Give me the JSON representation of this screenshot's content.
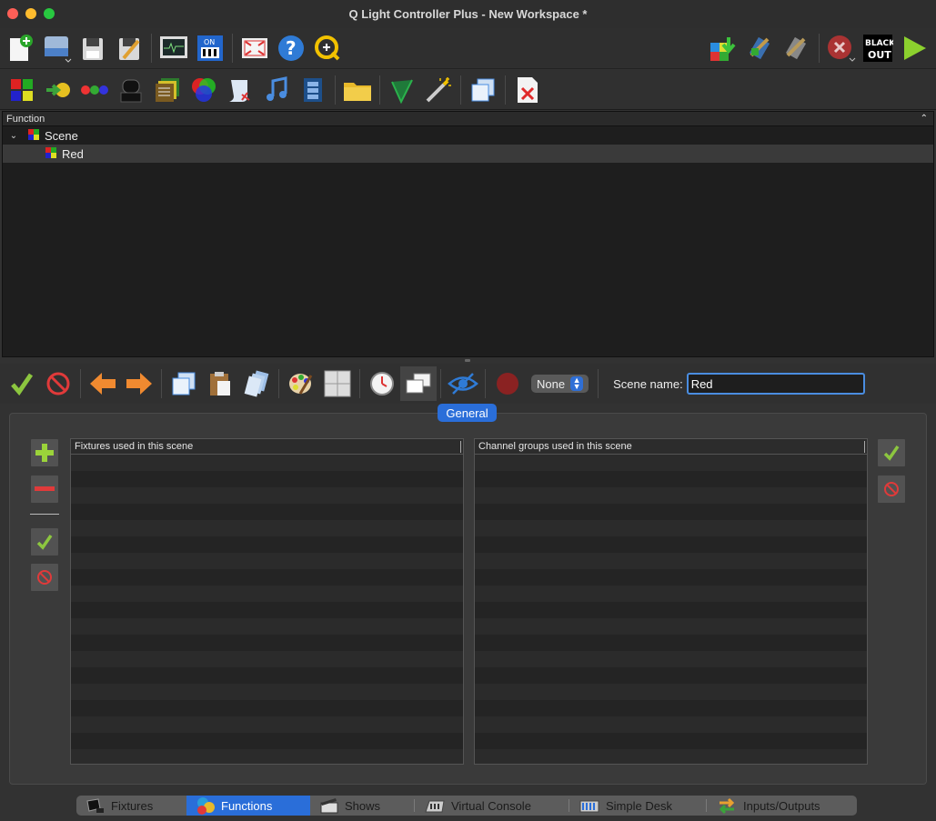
{
  "window": {
    "title": "Q Light Controller Plus - New Workspace *"
  },
  "main_toolbar": {
    "items": [
      "new-workspace",
      "open-workspace",
      "save-workspace",
      "save-as",
      "monitor",
      "dmx-dump",
      "fullscreen",
      "help",
      "about"
    ],
    "right_items": [
      "load-address-tool",
      "fixture-remap",
      "fixture-remap-alt",
      "stop-all",
      "blackout",
      "start-operate"
    ],
    "blackout_label_1": "BLACK",
    "blackout_label_2": "OUT"
  },
  "function_toolbar": {
    "items": [
      "new-scene",
      "new-chaser",
      "new-sequence",
      "new-efx",
      "new-collection",
      "new-rgb-matrix",
      "new-script",
      "new-audio",
      "new-show",
      "new-folder",
      "wizard-chaser",
      "function-wizard",
      "clone",
      "delete"
    ]
  },
  "function_tree": {
    "header": "Function",
    "items": [
      {
        "label": "Scene",
        "expanded": true,
        "children": [
          {
            "label": "Red",
            "selected": true
          }
        ]
      }
    ]
  },
  "scene_editor": {
    "toolbar": [
      "enable-all",
      "disable-all",
      "previous",
      "next",
      "copy",
      "paste",
      "copy-to-all",
      "color-tool",
      "position-tool",
      "speed-dial",
      "tabs-mode",
      "blind-mode",
      "record"
    ],
    "fade_combo": "None",
    "name_label": "Scene name:",
    "name_value": "Red",
    "tabs": [
      {
        "label": "General",
        "active": true
      }
    ],
    "fixtures_list_header": "Fixtures used in this scene",
    "channel_groups_header": "Channel groups used in this scene"
  },
  "bottom_tabs": [
    {
      "label": "Fixtures",
      "icon": "spotlight-icon",
      "active": false
    },
    {
      "label": "Functions",
      "icon": "functions-icon",
      "active": true
    },
    {
      "label": "Shows",
      "icon": "clapperboard-icon",
      "active": false
    },
    {
      "label": "Virtual Console",
      "icon": "console-icon",
      "active": false
    },
    {
      "label": "Simple Desk",
      "icon": "desk-icon",
      "active": false
    },
    {
      "label": "Inputs/Outputs",
      "icon": "io-arrows-icon",
      "active": false
    }
  ],
  "colors": {
    "accent": "#2a6ed9",
    "selection": "#3a3a3a",
    "check_green": "#8cc63f",
    "stop_red": "#e03a3a"
  }
}
